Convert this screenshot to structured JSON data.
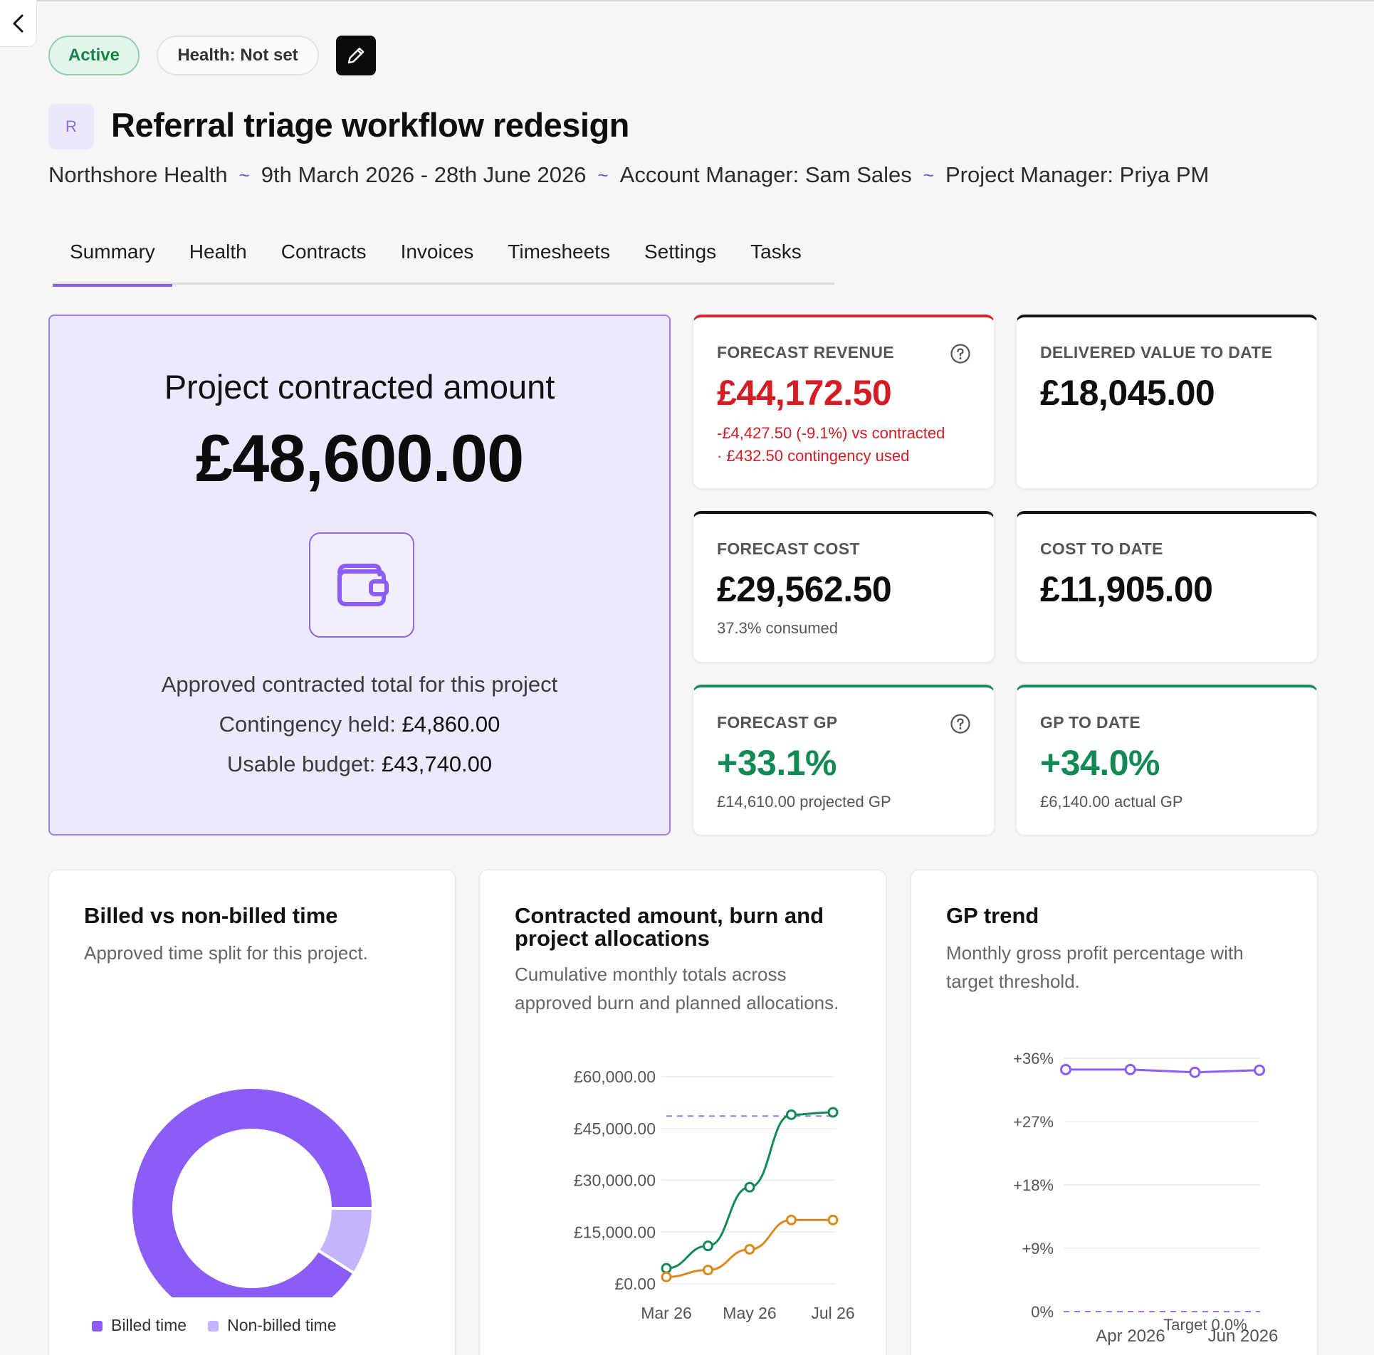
{
  "header": {
    "status_badge": "Active",
    "health_badge": "Health: Not set",
    "avatar_letter": "R",
    "title": "Referral triage workflow redesign",
    "client": "Northshore Health",
    "dates": "9th March 2026 - 28th June 2026",
    "account_manager": "Account Manager: Sam Sales",
    "project_manager": "Project Manager: Priya PM",
    "separator": "~"
  },
  "tabs": [
    "Summary",
    "Health",
    "Contracts",
    "Invoices",
    "Timesheets",
    "Settings",
    "Tasks"
  ],
  "selected_tab": "Summary",
  "hero": {
    "label": "Project contracted amount",
    "value": "£48,600.00",
    "caption": "Approved contracted total for this project",
    "contingency_label": "Contingency held:",
    "contingency_value": "£4,860.00",
    "budget_label": "Usable budget:",
    "budget_value": "£43,740.00",
    "icon": "wallet-icon"
  },
  "kpis": {
    "forecast_revenue": {
      "label": "FORECAST REVENUE",
      "value": "£44,172.50",
      "sub1": "-£4,427.50 (-9.1%) vs contracted",
      "sub2": "· £432.50 contingency used"
    },
    "delivered_value": {
      "label": "DELIVERED VALUE TO DATE",
      "value": "£18,045.00"
    },
    "forecast_cost": {
      "label": "FORECAST COST",
      "value": "£29,562.50",
      "sub": "37.3% consumed"
    },
    "cost_to_date": {
      "label": "COST TO DATE",
      "value": "£11,905.00"
    },
    "forecast_gp": {
      "label": "FORECAST GP",
      "value": "+33.1%",
      "sub": "£14,610.00 projected GP"
    },
    "gp_to_date": {
      "label": "GP TO DATE",
      "value": "+34.0%",
      "sub": "£6,140.00 actual GP"
    }
  },
  "cards": {
    "billed": {
      "title": "Billed vs non-billed time",
      "subtitle": "Approved time split for this project."
    },
    "burn": {
      "title": "Contracted amount, burn and project allocations",
      "subtitle": "Cumulative monthly totals across approved burn and planned allocations."
    },
    "gp": {
      "title": "GP trend",
      "subtitle": "Monthly gross profit percentage with target threshold."
    }
  },
  "colors": {
    "accent": "#8b5cf6",
    "accent_light": "#c4b5fd",
    "red": "#d31c23",
    "green": "#138a56",
    "orange": "#d98a1c"
  },
  "chart_data": [
    {
      "type": "pie",
      "title": "Billed vs non-billed time",
      "categories": [
        "Billed time",
        "Non-billed time"
      ],
      "values": [
        91,
        9
      ],
      "legend": "bottom"
    },
    {
      "type": "line",
      "title": "Contracted amount, burn and project allocations",
      "y_ticks": [
        "£60,000.00",
        "£45,000.00",
        "£30,000.00",
        "£15,000.00",
        "£0.00"
      ],
      "x_ticks": [
        "Mar 26",
        "May 26",
        "Jul 26"
      ],
      "ylim": [
        0,
        60000
      ],
      "x": [
        "Mar 26",
        "Apr 26",
        "May 26",
        "Jun 26",
        "Jul 26"
      ],
      "series": [
        {
          "values": [
            4500,
            11000,
            28000,
            49000,
            49700
          ],
          "color": "#138a56"
        },
        {
          "values": [
            2000,
            4000,
            10000,
            18500,
            18500
          ],
          "color": "#d98a1c"
        }
      ],
      "reference_line": {
        "value": 48600,
        "style": "dashed",
        "color": "#8b5cf6"
      },
      "grid": true
    },
    {
      "type": "line",
      "title": "GP trend",
      "y_ticks": [
        "+36%",
        "+27%",
        "+18%",
        "+9%",
        "0%"
      ],
      "x_ticks": [
        "Apr 2026",
        "Jun 2026"
      ],
      "ylim": [
        0,
        36
      ],
      "x": [
        "Mar 2026",
        "Apr 2026",
        "May 2026",
        "Jun 2026"
      ],
      "series": [
        {
          "values": [
            34.4,
            34.4,
            34.0,
            34.3
          ],
          "color": "#8b5cf6"
        }
      ],
      "reference_line": {
        "value": 0,
        "label": "Target 0.0%",
        "style": "dashed",
        "color": "#8b5cf6"
      },
      "grid": true
    }
  ]
}
